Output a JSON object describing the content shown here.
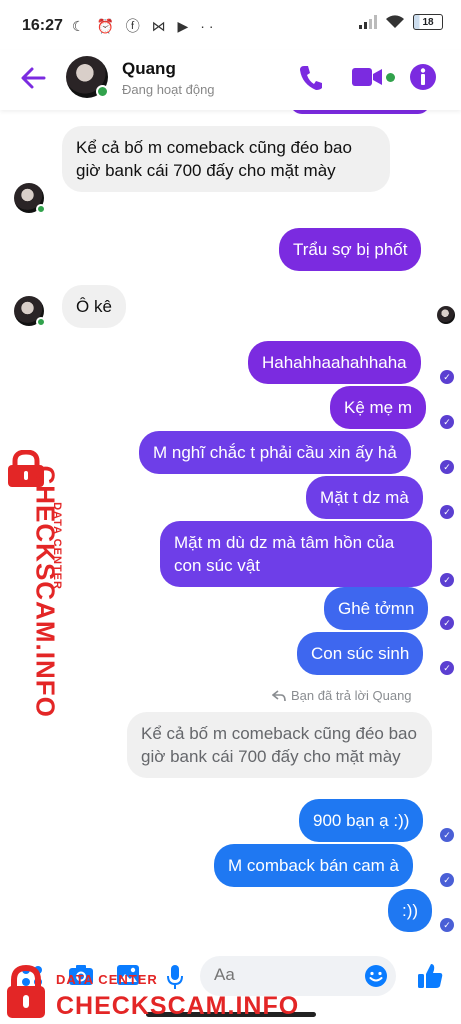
{
  "status_bar": {
    "time": "16:27",
    "left_icons": "☾ ⏰ ⓕ ⋈ ▶ ··",
    "battery": "18"
  },
  "header": {
    "name": "Quang",
    "status": "Đang hoạt động",
    "accent_color": "#7b2be0"
  },
  "messages": {
    "m1": "Kể cả bố m comeback cũng đéo bao giờ bank cái 700 đấy cho mặt mày",
    "m2": "Trẩu sợ bị phốt",
    "m3": "Ô kê",
    "m4": "Hahahhaahahhaha",
    "m5": "Kệ mẹ m",
    "m6": "M nghĩ chắc t phải cầu xin ấy hả",
    "m7": "Mặt t dz mà",
    "m8": "Mặt m dù dz mà tâm hồn của con súc vật",
    "m9": "Ghê tởmn",
    "m10": "Con súc sinh",
    "reply_note": "Bạn đã trả lời Quang",
    "quoted": "Kể cả bố m comeback cũng đéo bao giờ bank cái 700 đấy cho mặt mày",
    "m11": "900 bạn ạ :))",
    "m12": "M comback bán cam à",
    "m13": ":))"
  },
  "composer": {
    "placeholder": "Aa"
  },
  "watermark": {
    "sub": "DATA CENTER",
    "main": "CHECKSCAM.INFO"
  }
}
